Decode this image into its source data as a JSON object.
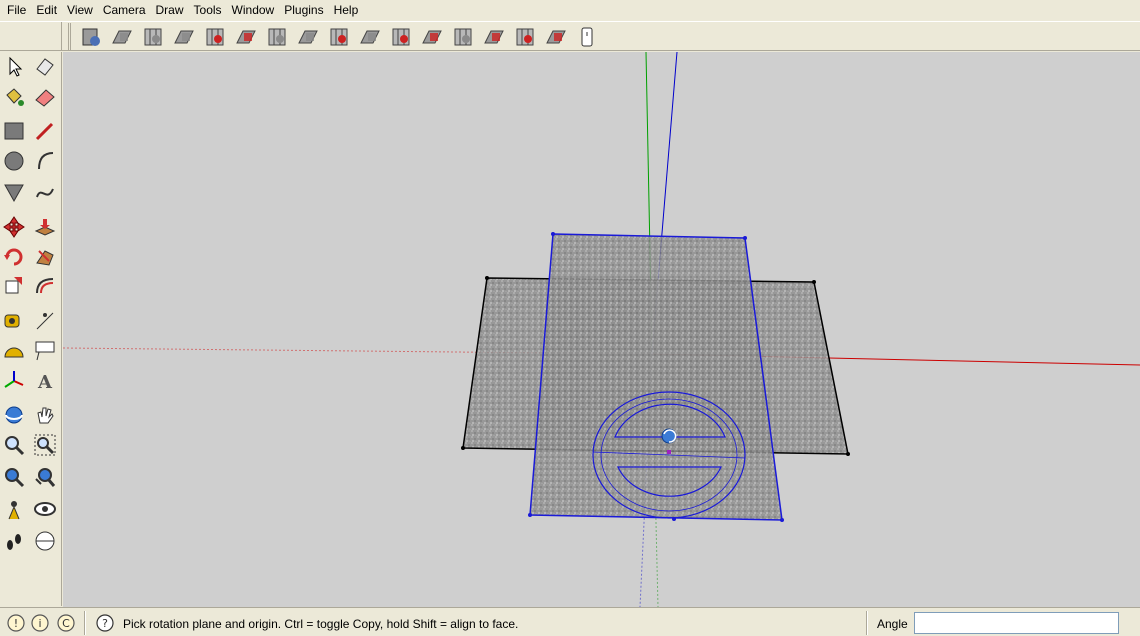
{
  "menu": [
    "File",
    "Edit",
    "View",
    "Camera",
    "Draw",
    "Tools",
    "Window",
    "Plugins",
    "Help"
  ],
  "toolbar": {
    "views": [
      {
        "name": "component-box-icon",
        "color": "#4a6fb5"
      },
      {
        "name": "iso-view-icon",
        "color": "#8a8a8a"
      },
      {
        "name": "top-view-icon",
        "color": "#8a8a8a"
      },
      {
        "name": "front-view-icon",
        "color": "#8a8a8a"
      },
      {
        "name": "right-view-icon",
        "color": "#cc2222"
      },
      {
        "name": "back-view-icon",
        "color": "#cc2222"
      },
      {
        "name": "left-view-icon",
        "color": "#8a8a8a"
      },
      {
        "name": "xray-icon",
        "color": "#8a8a8a"
      },
      {
        "name": "wireframe-icon",
        "color": "#cc2222"
      },
      {
        "name": "hidden-line-icon",
        "color": "#8a8a8a"
      },
      {
        "name": "shaded-icon",
        "color": "#cc2222"
      },
      {
        "name": "shaded-textures-icon",
        "color": "#cc2222"
      },
      {
        "name": "monochrome-icon",
        "color": "#8a8a8a"
      },
      {
        "name": "section-plane-icon",
        "color": "#cc2222"
      },
      {
        "name": "section-cut-icon",
        "color": "#cc2222"
      },
      {
        "name": "section-display-icon",
        "color": "#cc2222"
      },
      {
        "name": "scroll-icon",
        "color": "#333333"
      }
    ]
  },
  "palette": [
    "select-icon",
    "eraser-erase-icon",
    "paint-bucket-icon",
    "eraser-icon",
    "rectangle-icon",
    "pencil-icon",
    "circle-icon",
    "arc-icon",
    "polygon-icon",
    "freehand-icon",
    "move-icon",
    "push-pull-icon",
    "rotate-icon",
    "follow-me-icon",
    "scale-icon",
    "offset-icon",
    "tape-measure-icon",
    "dimension-icon",
    "protractor-icon",
    "text-icon",
    "axes-icon",
    "3d-text-icon",
    "orbit-icon",
    "pan-icon",
    "zoom-icon",
    "zoom-window-icon",
    "zoom-extents-icon",
    "previous-view-icon",
    "position-camera-icon",
    "look-around-icon",
    "walk-icon",
    "section-plane-tool-icon"
  ],
  "status": {
    "text": "Pick rotation plane and origin.  Ctrl = toggle Copy, hold Shift = align to face.",
    "measure_label": "Angle",
    "measure_value": ""
  },
  "colors": {
    "selection": "#1a1ad8",
    "red_axis": "#cc0000",
    "green_axis": "#00a000",
    "blue_axis": "#0000cc",
    "face": "#8c8c8c"
  }
}
